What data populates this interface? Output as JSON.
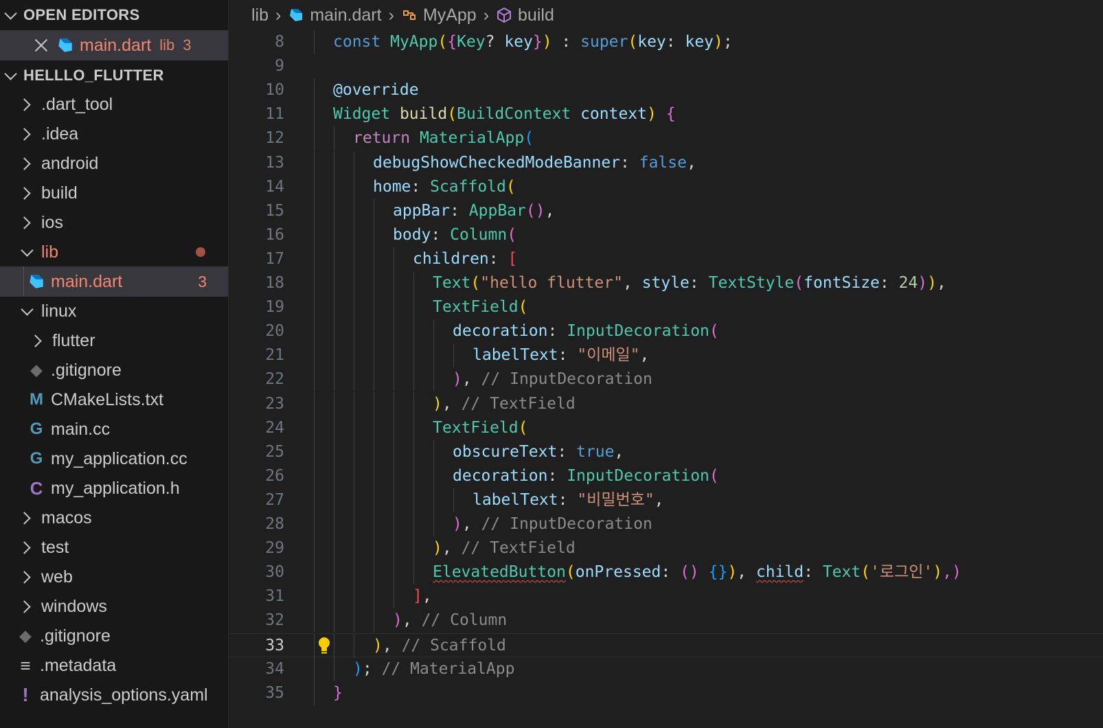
{
  "sidebar": {
    "open_editors_title": "OPEN EDITORS",
    "open_editor": {
      "name": "main.dart",
      "path": "lib",
      "problems": "3"
    },
    "project_title": "HELLLO_FLUTTER",
    "items": [
      {
        "label": ".dart_tool",
        "kind": "folder",
        "expanded": false
      },
      {
        "label": ".idea",
        "kind": "folder",
        "expanded": false
      },
      {
        "label": "android",
        "kind": "folder",
        "expanded": false
      },
      {
        "label": "build",
        "kind": "folder",
        "expanded": false
      },
      {
        "label": "ios",
        "kind": "folder",
        "expanded": false
      },
      {
        "label": "lib",
        "kind": "folder",
        "expanded": true
      },
      {
        "label": "main.dart",
        "kind": "dart-file",
        "badge": "3"
      },
      {
        "label": "linux",
        "kind": "folder",
        "expanded": true
      },
      {
        "label": "flutter",
        "kind": "folder",
        "expanded": false
      },
      {
        "label": ".gitignore",
        "kind": "git-file"
      },
      {
        "label": "CMakeLists.txt",
        "kind": "cmake-file"
      },
      {
        "label": "main.cc",
        "kind": "cpp-file"
      },
      {
        "label": "my_application.cc",
        "kind": "cpp-file"
      },
      {
        "label": "my_application.h",
        "kind": "c-header-file"
      },
      {
        "label": "macos",
        "kind": "folder",
        "expanded": false
      },
      {
        "label": "test",
        "kind": "folder",
        "expanded": false
      },
      {
        "label": "web",
        "kind": "folder",
        "expanded": false
      },
      {
        "label": "windows",
        "kind": "folder",
        "expanded": false
      },
      {
        "label": ".gitignore",
        "kind": "git-file"
      },
      {
        "label": ".metadata",
        "kind": "metadata-file"
      },
      {
        "label": "analysis_options.yaml",
        "kind": "yaml-file"
      }
    ]
  },
  "breadcrumbs": [
    "lib",
    "main.dart",
    "MyApp",
    "build"
  ],
  "editor": {
    "current_line": "33",
    "lines": [
      {
        "n": "8",
        "tokens": [
          [
            "const ",
            "kw"
          ],
          [
            "MyApp",
            "type"
          ],
          [
            "(",
            "y"
          ],
          [
            "{",
            "p"
          ],
          [
            "Key",
            "type"
          ],
          [
            "? ",
            "pun"
          ],
          [
            "key",
            "var"
          ],
          [
            "}",
            "p"
          ],
          [
            ")",
            "y"
          ],
          [
            " : ",
            "pun"
          ],
          [
            "super",
            "kw"
          ],
          [
            "(",
            "y"
          ],
          [
            "key",
            "var"
          ],
          [
            ": ",
            "pun"
          ],
          [
            "key",
            "var"
          ],
          [
            ")",
            "y"
          ],
          [
            ";",
            "pun"
          ]
        ]
      },
      {
        "n": "9",
        "tokens": []
      },
      {
        "n": "10",
        "tokens": [
          [
            "@override",
            "var"
          ]
        ]
      },
      {
        "n": "11",
        "tokens": [
          [
            "Widget ",
            "type"
          ],
          [
            "build",
            "fn"
          ],
          [
            "(",
            "y"
          ],
          [
            "BuildContext ",
            "type"
          ],
          [
            "context",
            "var"
          ],
          [
            ") ",
            "y"
          ],
          [
            "{",
            "p"
          ]
        ]
      },
      {
        "n": "12",
        "tokens": [
          [
            "return ",
            "ctl"
          ],
          [
            "MaterialApp",
            "type"
          ],
          [
            "(",
            "b"
          ]
        ]
      },
      {
        "n": "13",
        "tokens": [
          [
            "debugShowCheckedModeBanner",
            "var"
          ],
          [
            ": ",
            "pun"
          ],
          [
            "false",
            "kw"
          ],
          [
            ",",
            "pun"
          ]
        ]
      },
      {
        "n": "14",
        "tokens": [
          [
            "home",
            "var"
          ],
          [
            ": ",
            "pun"
          ],
          [
            "Scaffold",
            "type"
          ],
          [
            "(",
            "y"
          ]
        ]
      },
      {
        "n": "15",
        "tokens": [
          [
            "appBar",
            "var"
          ],
          [
            ": ",
            "pun"
          ],
          [
            "AppBar",
            "type"
          ],
          [
            "()",
            "p"
          ],
          [
            ",",
            "pun"
          ]
        ]
      },
      {
        "n": "16",
        "tokens": [
          [
            "body",
            "var"
          ],
          [
            ": ",
            "pun"
          ],
          [
            "Column",
            "type"
          ],
          [
            "(",
            "p"
          ]
        ]
      },
      {
        "n": "17",
        "tokens": [
          [
            "children",
            "var"
          ],
          [
            ": ",
            "pun"
          ],
          [
            "[",
            "r"
          ]
        ]
      },
      {
        "n": "18",
        "tokens": [
          [
            "Text",
            "type"
          ],
          [
            "(",
            "y"
          ],
          [
            "\"hello flutter\"",
            "str"
          ],
          [
            ", ",
            "pun"
          ],
          [
            "style",
            "var"
          ],
          [
            ": ",
            "pun"
          ],
          [
            "TextStyle",
            "type"
          ],
          [
            "(",
            "p"
          ],
          [
            "fontSize",
            "var"
          ],
          [
            ": ",
            "pun"
          ],
          [
            "24",
            "num"
          ],
          [
            ")",
            "p"
          ],
          [
            ")",
            "y"
          ],
          [
            ",",
            "pun"
          ]
        ]
      },
      {
        "n": "19",
        "tokens": [
          [
            "TextField",
            "type"
          ],
          [
            "(",
            "y"
          ]
        ]
      },
      {
        "n": "20",
        "tokens": [
          [
            "decoration",
            "var"
          ],
          [
            ": ",
            "pun"
          ],
          [
            "InputDecoration",
            "type"
          ],
          [
            "(",
            "p"
          ]
        ]
      },
      {
        "n": "21",
        "tokens": [
          [
            "labelText",
            "var"
          ],
          [
            ": ",
            "pun"
          ],
          [
            "\"이메일\"",
            "str"
          ],
          [
            ",",
            "pun"
          ]
        ]
      },
      {
        "n": "22",
        "tokens": [
          [
            ")",
            "p"
          ],
          [
            ", ",
            "pun"
          ],
          [
            "// InputDecoration",
            "cmt"
          ]
        ]
      },
      {
        "n": "23",
        "tokens": [
          [
            ")",
            "y"
          ],
          [
            ", ",
            "pun"
          ],
          [
            "// TextField",
            "cmt"
          ]
        ]
      },
      {
        "n": "24",
        "tokens": [
          [
            "TextField",
            "type"
          ],
          [
            "(",
            "y"
          ]
        ]
      },
      {
        "n": "25",
        "tokens": [
          [
            "obscureText",
            "var"
          ],
          [
            ": ",
            "pun"
          ],
          [
            "true",
            "kw"
          ],
          [
            ",",
            "pun"
          ]
        ]
      },
      {
        "n": "26",
        "tokens": [
          [
            "decoration",
            "var"
          ],
          [
            ": ",
            "pun"
          ],
          [
            "InputDecoration",
            "type"
          ],
          [
            "(",
            "p"
          ]
        ]
      },
      {
        "n": "27",
        "tokens": [
          [
            "labelText",
            "var"
          ],
          [
            ": ",
            "pun"
          ],
          [
            "\"비밀번호\"",
            "str"
          ],
          [
            ",",
            "pun"
          ]
        ]
      },
      {
        "n": "28",
        "tokens": [
          [
            ")",
            "p"
          ],
          [
            ", ",
            "pun"
          ],
          [
            "// InputDecoration",
            "cmt"
          ]
        ]
      },
      {
        "n": "29",
        "tokens": [
          [
            ")",
            "y"
          ],
          [
            ", ",
            "pun"
          ],
          [
            "// TextField",
            "cmt"
          ]
        ]
      },
      {
        "n": "30",
        "tokens": [
          [
            "ElevatedButton",
            "type-err"
          ],
          [
            "(",
            "y"
          ],
          [
            "onPressed",
            "var"
          ],
          [
            ": ",
            "pun"
          ],
          [
            "() ",
            "p"
          ],
          [
            "{}",
            "b"
          ],
          [
            ")",
            "y"
          ],
          [
            ", ",
            "pun"
          ],
          [
            "child",
            "var-err"
          ],
          [
            ": ",
            "pun"
          ],
          [
            "Text",
            "type"
          ],
          [
            "(",
            "y"
          ],
          [
            "'로그인'",
            "str"
          ],
          [
            ")",
            "y"
          ],
          [
            ",)",
            "p"
          ]
        ]
      },
      {
        "n": "31",
        "tokens": [
          [
            "]",
            "r"
          ],
          [
            ",",
            "pun"
          ]
        ]
      },
      {
        "n": "32",
        "tokens": [
          [
            ")",
            "p"
          ],
          [
            ", ",
            "pun"
          ],
          [
            "// Column",
            "cmt"
          ]
        ]
      },
      {
        "n": "33",
        "tokens": [
          [
            ")",
            "y"
          ],
          [
            ", ",
            "pun"
          ],
          [
            "// Scaffold",
            "cmt"
          ]
        ]
      },
      {
        "n": "34",
        "tokens": [
          [
            ")",
            "b"
          ],
          [
            ";",
            "pun"
          ],
          [
            " // MaterialApp",
            "cmt"
          ]
        ]
      },
      {
        "n": "35",
        "tokens": [
          [
            "}",
            "p"
          ]
        ]
      }
    ]
  },
  "colors": {
    "sidebar_bg": "#181818",
    "editor_bg": "#1f1f1f",
    "error_text": "#f48771",
    "active_row": "#37373d"
  }
}
